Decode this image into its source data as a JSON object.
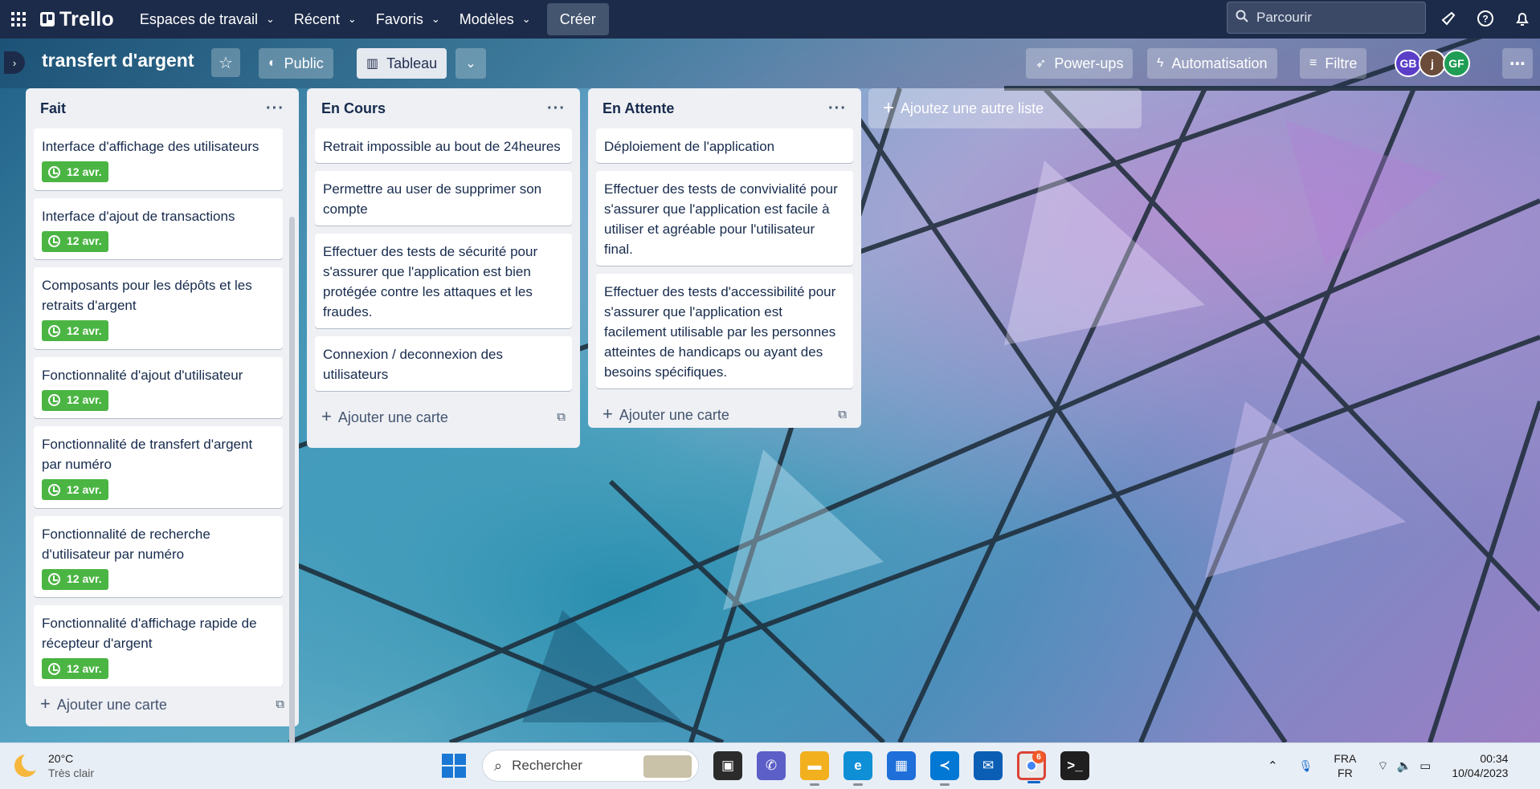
{
  "nav": {
    "app_name": "Trello",
    "menu": [
      {
        "label": "Espaces de travail"
      },
      {
        "label": "Récent"
      },
      {
        "label": "Favoris"
      },
      {
        "label": "Modèles"
      }
    ],
    "create_label": "Créer",
    "search_placeholder": "Parcourir",
    "user_initials": "GB"
  },
  "board": {
    "title": "transfert d'argent",
    "visibility_label": "Public",
    "view_label": "Tableau",
    "powerups_label": "Power-ups",
    "automation_label": "Automatisation",
    "filter_label": "Filtre",
    "members": [
      {
        "initials": "GB",
        "color": "#5b3ec8"
      },
      {
        "initials": "j",
        "color": "#6b4b3a"
      },
      {
        "initials": "GF",
        "color": "#1f9d55"
      }
    ]
  },
  "lists": [
    {
      "title": "Fait",
      "cards": [
        {
          "title": "Interface d'affichage des utilisateurs",
          "due": "12 avr."
        },
        {
          "title": "Interface d'ajout de transactions",
          "due": "12 avr."
        },
        {
          "title": "Composants pour les dépôts et les retraits d'argent",
          "due": "12 avr."
        },
        {
          "title": "Fonctionnalité d'ajout d'utilisateur",
          "due": "12 avr."
        },
        {
          "title": "Fonctionnalité de transfert d'argent par numéro",
          "due": "12 avr."
        },
        {
          "title": "Fonctionnalité de recherche d'utilisateur par numéro",
          "due": "12 avr."
        },
        {
          "title": "Fonctionnalité d'affichage rapide de récepteur d'argent",
          "due": "12 avr."
        }
      ]
    },
    {
      "title": "En Cours",
      "cards": [
        {
          "title": "Retrait impossible au bout de 24heures"
        },
        {
          "title": "Permettre au user de supprimer son compte"
        },
        {
          "title": "Effectuer des tests de sécurité pour s'assurer que l'application est bien protégée contre les attaques et les fraudes."
        },
        {
          "title": "Connexion / deconnexion des utilisateurs"
        }
      ]
    },
    {
      "title": "En Attente",
      "cards": [
        {
          "title": "Déploiement de l'application"
        },
        {
          "title": "Effectuer des tests de convivialité pour s'assurer que l'application est facile à utiliser et agréable pour l'utilisateur final."
        },
        {
          "title": "Effectuer des tests d'accessibilité pour s'assurer que l'application est facilement utilisable par les personnes atteintes de handicaps ou ayant des besoins spécifiques."
        }
      ]
    }
  ],
  "add_card_label": "Ajouter une carte",
  "add_list_label": "Ajoutez une autre liste",
  "taskbar": {
    "temperature": "20°C",
    "weather": "Très clair",
    "search_label": "Rechercher",
    "chrome_badge": "6",
    "lang_top": "FRA",
    "lang_bottom": "FR",
    "time": "00:34",
    "date": "10/04/2023"
  }
}
